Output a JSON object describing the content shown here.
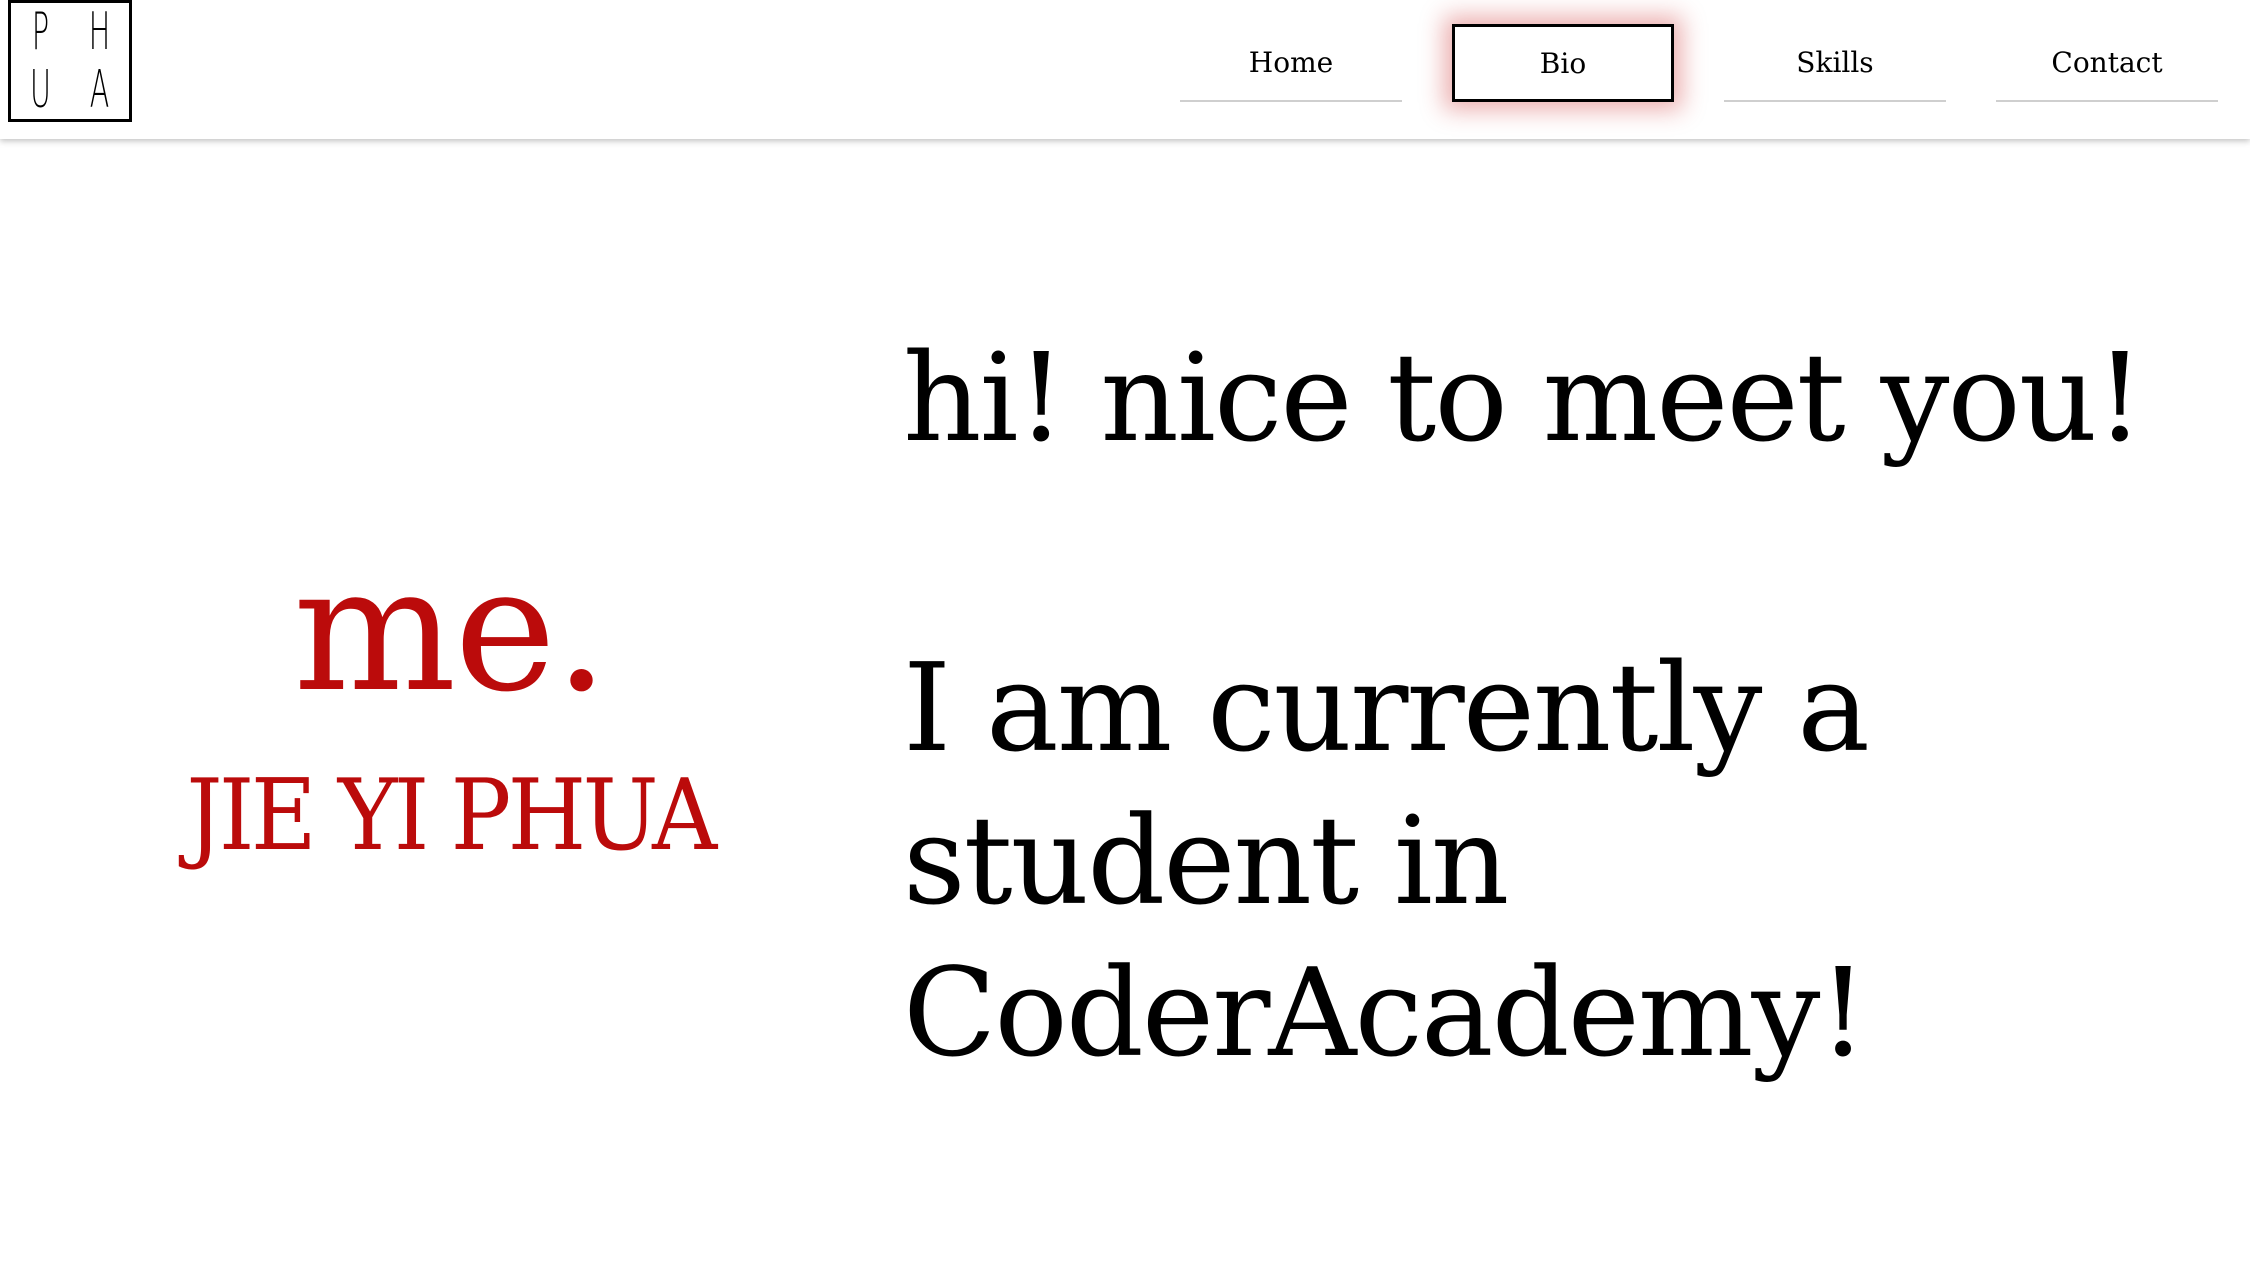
{
  "logo": {
    "letters": [
      "P",
      "H",
      "U",
      "A"
    ]
  },
  "nav": {
    "items": [
      {
        "label": "Home"
      },
      {
        "label": "Bio"
      },
      {
        "label": "Skills"
      },
      {
        "label": "Contact"
      }
    ],
    "active": "Bio"
  },
  "bio": {
    "heading": "me.",
    "name": "JIE YI PHUA",
    "greeting": "hi! nice to meet you!",
    "statement": "I am currently a student in CoderAcademy!"
  },
  "colors": {
    "accent": "#bb0b0b",
    "text": "#000000",
    "background": "#ffffff"
  }
}
